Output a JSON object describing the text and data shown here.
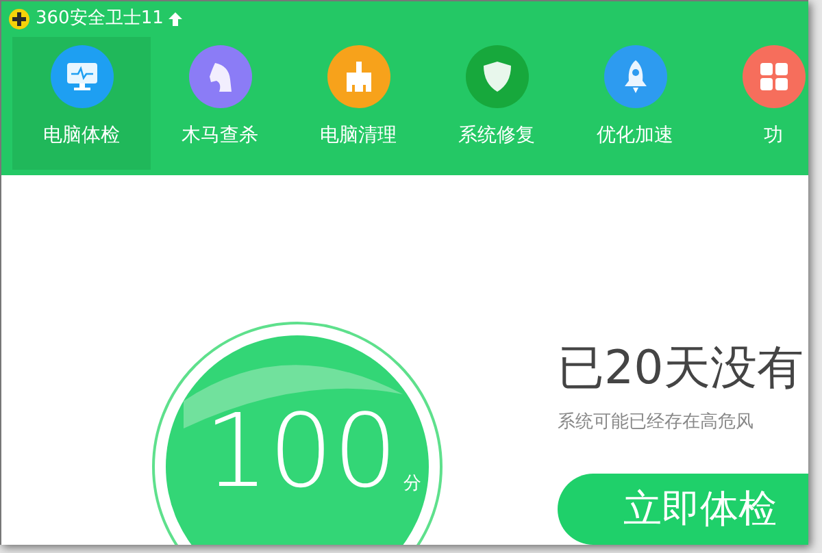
{
  "window": {
    "title": "360安全卫士11"
  },
  "tabs": [
    {
      "label": "电脑体检",
      "selected": true,
      "color": "#1e9ff2"
    },
    {
      "label": "木马查杀",
      "selected": false,
      "color": "#8b7cf6"
    },
    {
      "label": "电脑清理",
      "selected": false,
      "color": "#f7a21b"
    },
    {
      "label": "系统修复",
      "selected": false,
      "color": "#17a83c"
    },
    {
      "label": "优化加速",
      "selected": false,
      "color": "#2d9bf0"
    },
    {
      "label": "功",
      "selected": false,
      "color": "#f66e5c"
    }
  ],
  "score": {
    "value": "100",
    "unit": "分"
  },
  "headline": "已20天没有",
  "subtitle": "系统可能已经存在高危风",
  "scan_button": "立即体检"
}
